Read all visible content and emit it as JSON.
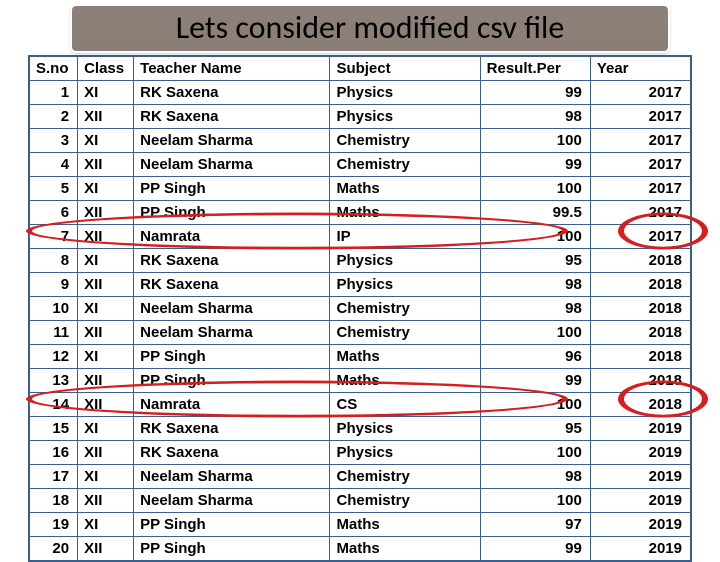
{
  "title": "Lets consider modified csv file",
  "headers": {
    "sno": "S.no",
    "class": "Class",
    "teacher": "Teacher Name",
    "subject": "Subject",
    "result": "Result.Per",
    "year": "Year"
  },
  "rows": [
    {
      "sno": "1",
      "class": "XI",
      "teacher": "RK Saxena",
      "subject": "Physics",
      "result": "99",
      "year": "2017"
    },
    {
      "sno": "2",
      "class": "XII",
      "teacher": "RK Saxena",
      "subject": "Physics",
      "result": "98",
      "year": "2017"
    },
    {
      "sno": "3",
      "class": "XI",
      "teacher": "Neelam Sharma",
      "subject": "Chemistry",
      "result": "100",
      "year": "2017"
    },
    {
      "sno": "4",
      "class": "XII",
      "teacher": "Neelam Sharma",
      "subject": "Chemistry",
      "result": "99",
      "year": "2017"
    },
    {
      "sno": "5",
      "class": "XI",
      "teacher": "PP Singh",
      "subject": "Maths",
      "result": "100",
      "year": "2017"
    },
    {
      "sno": "6",
      "class": "XII",
      "teacher": "PP Singh",
      "subject": "Maths",
      "result": "99.5",
      "year": "2017"
    },
    {
      "sno": "7",
      "class": "XII",
      "teacher": "Namrata",
      "subject": "IP",
      "result": "100",
      "year": "2017"
    },
    {
      "sno": "8",
      "class": "XI",
      "teacher": "RK Saxena",
      "subject": "Physics",
      "result": "95",
      "year": "2018"
    },
    {
      "sno": "9",
      "class": "XII",
      "teacher": "RK Saxena",
      "subject": "Physics",
      "result": "98",
      "year": "2018"
    },
    {
      "sno": "10",
      "class": "XI",
      "teacher": "Neelam Sharma",
      "subject": "Chemistry",
      "result": "98",
      "year": "2018"
    },
    {
      "sno": "11",
      "class": "XII",
      "teacher": "Neelam Sharma",
      "subject": "Chemistry",
      "result": "100",
      "year": "2018"
    },
    {
      "sno": "12",
      "class": "XI",
      "teacher": "PP Singh",
      "subject": "Maths",
      "result": "96",
      "year": "2018"
    },
    {
      "sno": "13",
      "class": "XII",
      "teacher": "PP Singh",
      "subject": "Maths",
      "result": "99",
      "year": "2018"
    },
    {
      "sno": "14",
      "class": "XII",
      "teacher": "Namrata",
      "subject": "CS",
      "result": "100",
      "year": "2018"
    },
    {
      "sno": "15",
      "class": "XI",
      "teacher": "RK Saxena",
      "subject": "Physics",
      "result": "95",
      "year": "2019"
    },
    {
      "sno": "16",
      "class": "XII",
      "teacher": "RK Saxena",
      "subject": "Physics",
      "result": "100",
      "year": "2019"
    },
    {
      "sno": "17",
      "class": "XI",
      "teacher": "Neelam Sharma",
      "subject": "Chemistry",
      "result": "98",
      "year": "2019"
    },
    {
      "sno": "18",
      "class": "XII",
      "teacher": "Neelam Sharma",
      "subject": "Chemistry",
      "result": "100",
      "year": "2019"
    },
    {
      "sno": "19",
      "class": "XI",
      "teacher": "PP Singh",
      "subject": "Maths",
      "result": "97",
      "year": "2019"
    },
    {
      "sno": "20",
      "class": "XII",
      "teacher": "PP Singh",
      "subject": "Maths",
      "result": "99",
      "year": "2019"
    }
  ],
  "chart_data": {
    "type": "table",
    "title": "Lets consider modified csv file",
    "columns": [
      "S.no",
      "Class",
      "Teacher Name",
      "Subject",
      "Result.Per",
      "Year"
    ],
    "data": [
      [
        1,
        "XI",
        "RK Saxena",
        "Physics",
        99,
        2017
      ],
      [
        2,
        "XII",
        "RK Saxena",
        "Physics",
        98,
        2017
      ],
      [
        3,
        "XI",
        "Neelam Sharma",
        "Chemistry",
        100,
        2017
      ],
      [
        4,
        "XII",
        "Neelam Sharma",
        "Chemistry",
        99,
        2017
      ],
      [
        5,
        "XI",
        "PP Singh",
        "Maths",
        100,
        2017
      ],
      [
        6,
        "XII",
        "PP Singh",
        "Maths",
        99.5,
        2017
      ],
      [
        7,
        "XII",
        "Namrata",
        "IP",
        100,
        2017
      ],
      [
        8,
        "XI",
        "RK Saxena",
        "Physics",
        95,
        2018
      ],
      [
        9,
        "XII",
        "RK Saxena",
        "Physics",
        98,
        2018
      ],
      [
        10,
        "XI",
        "Neelam Sharma",
        "Chemistry",
        98,
        2018
      ],
      [
        11,
        "XII",
        "Neelam Sharma",
        "Chemistry",
        100,
        2018
      ],
      [
        12,
        "XI",
        "PP Singh",
        "Maths",
        96,
        2018
      ],
      [
        13,
        "XII",
        "PP Singh",
        "Maths",
        99,
        2018
      ],
      [
        14,
        "XII",
        "Namrata",
        "CS",
        100,
        2018
      ],
      [
        15,
        "XI",
        "RK Saxena",
        "Physics",
        95,
        2019
      ],
      [
        16,
        "XII",
        "RK Saxena",
        "Physics",
        100,
        2019
      ],
      [
        17,
        "XI",
        "Neelam Sharma",
        "Chemistry",
        98,
        2019
      ],
      [
        18,
        "XII",
        "Neelam Sharma",
        "Chemistry",
        100,
        2019
      ],
      [
        19,
        "XI",
        "PP Singh",
        "Maths",
        97,
        2019
      ],
      [
        20,
        "XII",
        "PP Singh",
        "Maths",
        99,
        2019
      ]
    ]
  }
}
